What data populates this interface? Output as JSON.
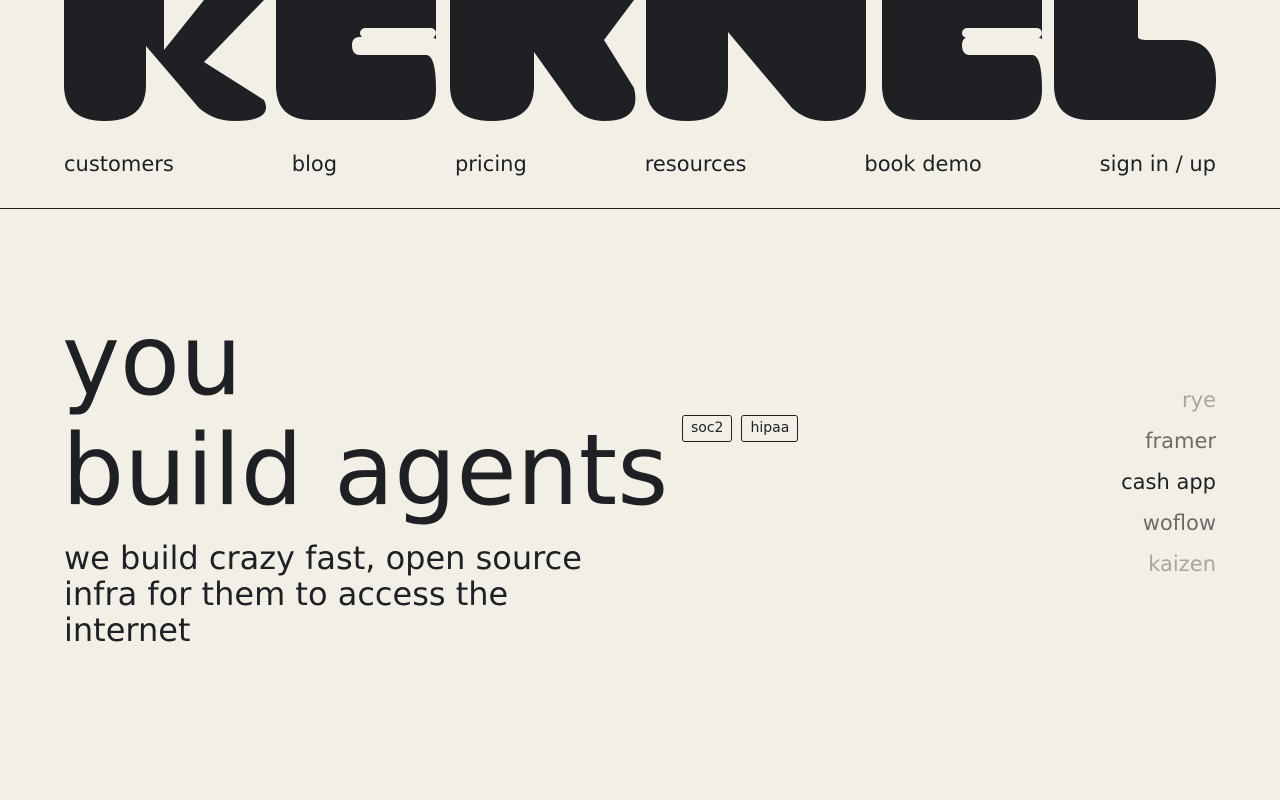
{
  "brand": {
    "logo_text": "KERNEL",
    "logo_color": "#1e2024"
  },
  "nav": {
    "items": [
      {
        "label": "customers"
      },
      {
        "label": "blog"
      },
      {
        "label": "pricing"
      },
      {
        "label": "resources"
      },
      {
        "label": "book demo"
      },
      {
        "label": "sign in / up"
      }
    ]
  },
  "hero": {
    "line1": "you",
    "line2": "build agents",
    "badges": [
      "soc2",
      "hipaa"
    ],
    "subhead": "we build crazy fast, open source infra for them to access the internet"
  },
  "customer_ticker": {
    "items": [
      {
        "name": "rye",
        "emphasis": "faint"
      },
      {
        "name": "framer",
        "emphasis": "mid"
      },
      {
        "name": "cash app",
        "emphasis": "strong"
      },
      {
        "name": "woflow",
        "emphasis": "mid"
      },
      {
        "name": "kaizen",
        "emphasis": "faint"
      }
    ]
  },
  "colors": {
    "background": "#f2efe7",
    "text": "#1e2024",
    "faint": "#a9a6a0",
    "mid": "#6e6c69"
  }
}
